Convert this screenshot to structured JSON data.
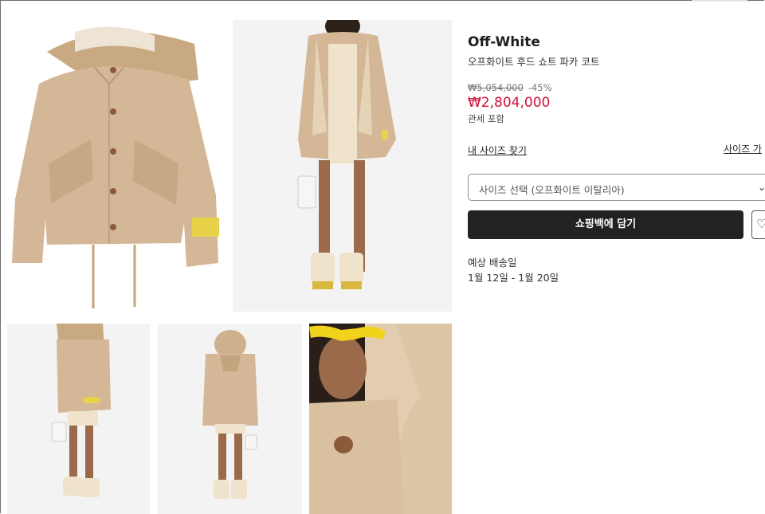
{
  "product": {
    "brand": "Off-White",
    "name": "오프화이트 후드 쇼트 파카 코트",
    "original_price": "₩5,054,000",
    "discount": "-45%",
    "price": "₩2,804,000",
    "duty_note": "관세 포함"
  },
  "links": {
    "size_finder": "내 사이즈 찾기",
    "size_guide": "사이즈 가"
  },
  "size_select": {
    "placeholder": "사이즈 선택 (오프화이트 이탈리아)"
  },
  "actions": {
    "add_to_bag": "쇼핑백에 담기"
  },
  "shipping": {
    "label": "예상 배송일",
    "dates": "1월 12일 - 1월 20일"
  },
  "gallery": {
    "images": [
      "coat-front",
      "model-front",
      "model-side",
      "model-back",
      "hood-detail"
    ]
  },
  "colors": {
    "accent_price": "#d0103a",
    "button_bg": "#222222",
    "coat": "#d4b796"
  }
}
